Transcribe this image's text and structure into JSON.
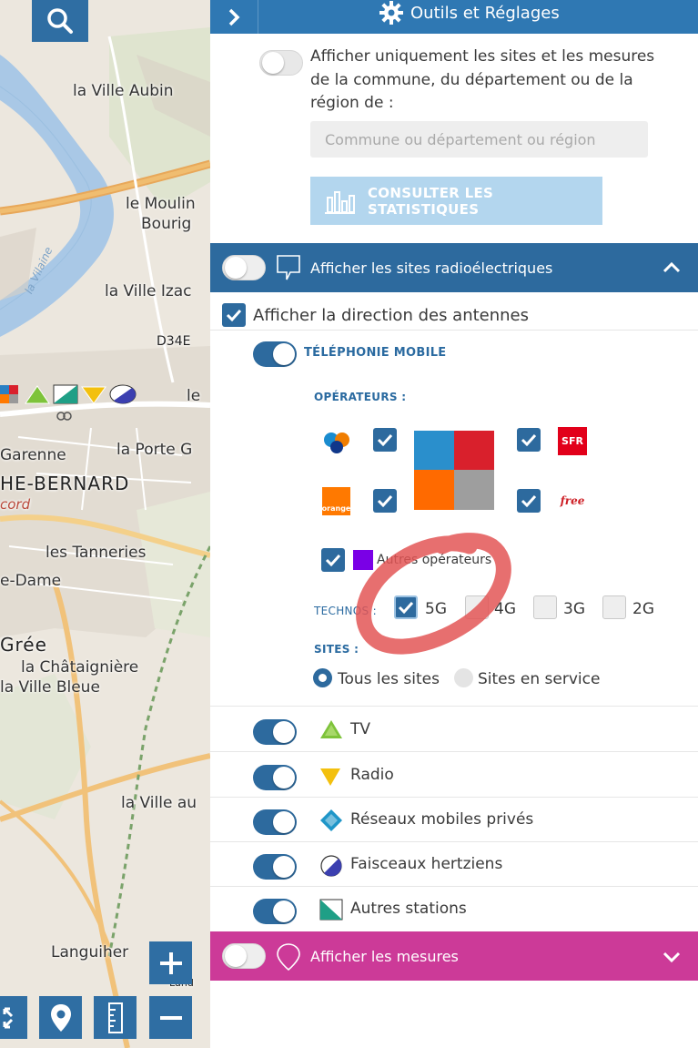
{
  "map": {
    "labels": {
      "ville_aubin": "la Ville Aubin",
      "moulin": "le Moulin",
      "bourig": "Bourig",
      "vilaine": "la Vilaine",
      "ville_izac": "la Ville Izac",
      "d34e": "D34E",
      "le": "le",
      "garenne": "Garenne",
      "porte": "la Porte G",
      "he_bernard": "HE-BERNARD",
      "cord": "cord",
      "tanneries": "les Tanneries",
      "dame": "e-Dame",
      "gree": "Grée",
      "chataigniere": "la Châtaignière",
      "ville_bleue": "la Ville Bleue",
      "ville_au": "la Ville au",
      "languiher": "Languiher",
      "lund": "Lund"
    }
  },
  "panel": {
    "header_title": "Outils et Réglages",
    "filter_text": "Afficher uniquement les sites et les mesures de la commune, du département ou de la région de :",
    "commune_placeholder": "Commune ou département ou région",
    "stats_button": "CONSULTER LES STATISTIQUES",
    "radio_sites_band": "Afficher les sites radioélectriques",
    "antenna_direction": "Afficher la direction des antennes",
    "telephonie": "TÉLÉPHONIE MOBILE",
    "operateurs": "OPÉRATEURS :",
    "operators": {
      "sfr": "SFR",
      "orange": "orange",
      "free": "free",
      "autres": "Autres opérateurs"
    },
    "technos_label": "TECHNOS :",
    "technos": [
      "5G",
      "4G",
      "3G",
      "2G"
    ],
    "sites_label": "SITES :",
    "sites_options": [
      "Tous les sites",
      "Sites en service"
    ],
    "layers": [
      "TV",
      "Radio",
      "Réseaux mobiles privés",
      "Faisceaux hertziens",
      "Autres stations"
    ],
    "mesures_band": "Afficher les mesures"
  },
  "colors": {
    "header_blue": "#2f78b3",
    "band_blue": "#2d6a9e",
    "band_pink": "#cc3a98",
    "stats_button_bg": "#b3d6ee",
    "annotation_red": "#e35656"
  }
}
